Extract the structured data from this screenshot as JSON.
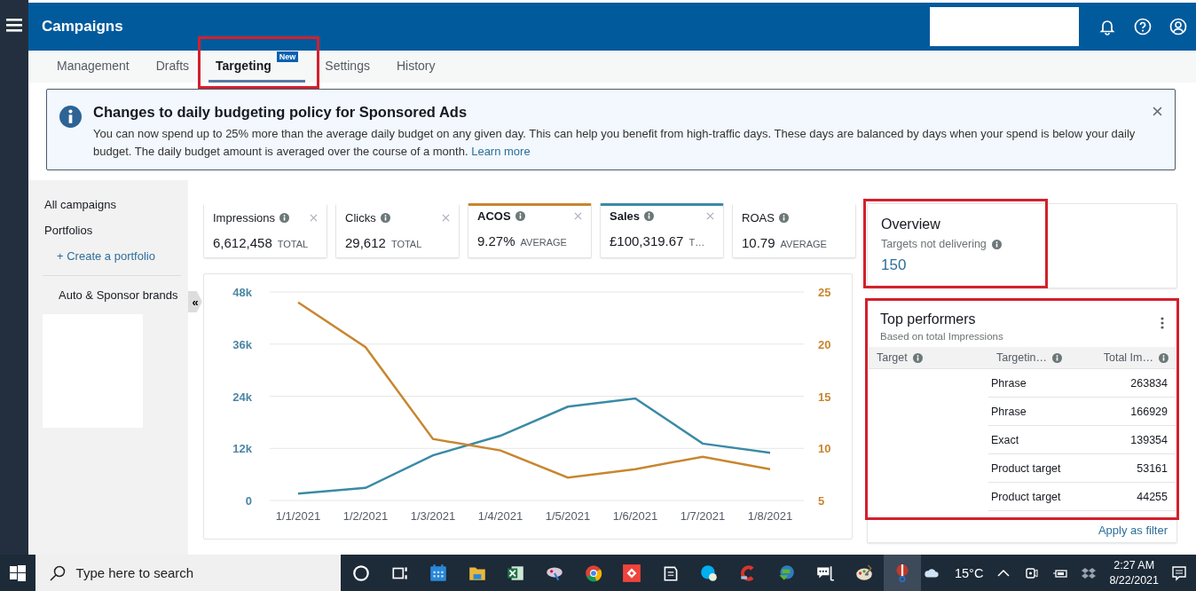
{
  "header": {
    "title": "Campaigns"
  },
  "tabs": [
    {
      "label": "Management",
      "selected": false,
      "highlighted": false
    },
    {
      "label": "Drafts",
      "selected": false,
      "highlighted": false
    },
    {
      "label": "Targeting",
      "selected": true,
      "highlighted": true,
      "badge": "New"
    },
    {
      "label": "Settings",
      "selected": false,
      "highlighted": false
    },
    {
      "label": "History",
      "selected": false,
      "highlighted": false
    }
  ],
  "banner": {
    "title": "Changes to daily budgeting policy for Sponsored Ads",
    "text": "You can now spend up to 25% more than the average daily budget on any given day. This can help you benefit from high-traffic days. These days are balanced by days when your spend is below your daily budget. The daily budget amount is averaged over the course of a month.",
    "link": "Learn more"
  },
  "sidebar": {
    "items": [
      {
        "label": "All campaigns",
        "kind": "heading"
      },
      {
        "label": "Portfolios",
        "kind": "heading"
      },
      {
        "label": "+ Create a portfolio",
        "kind": "link"
      },
      {
        "label": "Auto & Sponsor brands",
        "kind": "item"
      }
    ],
    "collapse": "«"
  },
  "metrics": [
    {
      "label": "Impressions",
      "value": "6,612,458",
      "unit": "TOTAL",
      "selected": false,
      "closable": true
    },
    {
      "label": "Clicks",
      "value": "29,612",
      "unit": "TOTAL",
      "selected": false,
      "closable": true
    },
    {
      "label": "ACOS",
      "value": "9.27%",
      "unit": "AVERAGE",
      "selected": true,
      "color": "#c8862f",
      "closable": true
    },
    {
      "label": "Sales",
      "value": "£100,319.67",
      "unit": "T…",
      "selected": true,
      "color": "#3b8aa5",
      "closable": true
    },
    {
      "label": "ROAS",
      "value": "10.79",
      "unit": "AVERAGE",
      "selected": false,
      "closable": false
    }
  ],
  "chart_data": {
    "type": "line",
    "categories": [
      "1/1/2021",
      "1/2/2021",
      "1/3/2021",
      "1/4/2021",
      "1/5/2021",
      "1/6/2021",
      "1/7/2021",
      "1/8/2021"
    ],
    "series": [
      {
        "color": "#3b8aa5",
        "values": [
          1600,
          2900,
          10400,
          14900,
          21600,
          23500,
          13100,
          11000
        ]
      },
      {
        "color": "#c8862f",
        "axis": "y2",
        "values": [
          24,
          19.7,
          10.9,
          9.8,
          7.2,
          8,
          9.2,
          8
        ]
      }
    ],
    "ylim": [
      0,
      48000
    ],
    "yticks": [
      {
        "value": 0,
        "label": "0"
      },
      {
        "value": 12000,
        "label": "12k"
      },
      {
        "value": 24000,
        "label": "24k"
      },
      {
        "value": 36000,
        "label": "36k"
      },
      {
        "value": 48000,
        "label": "48k"
      }
    ],
    "grid": true,
    "y2lim": [
      5,
      25
    ],
    "y2ticks": [
      5,
      10,
      15,
      20,
      25
    ]
  },
  "overview": {
    "title": "Overview",
    "label": "Targets not delivering",
    "value": "150",
    "highlighted": true
  },
  "top_performers": {
    "title": "Top performers",
    "subtitle": "Based on total Impressions",
    "highlighted": true,
    "columns": [
      "Target",
      "Targetin…",
      "Total Im…"
    ],
    "rows": [
      {
        "targeting": "Phrase",
        "impressions": "263834"
      },
      {
        "targeting": "Phrase",
        "impressions": "166929"
      },
      {
        "targeting": "Exact",
        "impressions": "139354"
      },
      {
        "targeting": "Product target",
        "impressions": "53161"
      },
      {
        "targeting": "Product target",
        "impressions": "44255"
      }
    ],
    "link": "Apply as filter"
  },
  "taskbar": {
    "search_placeholder": "Type here to search",
    "apps": [
      {
        "kind": "cortana",
        "selected": false
      },
      {
        "kind": "taskview",
        "selected": false
      },
      {
        "kind": "calendar",
        "selected": false
      },
      {
        "kind": "folder",
        "selected": false
      },
      {
        "kind": "spreadsheet",
        "selected": false
      },
      {
        "kind": "paint",
        "selected": false
      },
      {
        "kind": "browser",
        "selected": false
      },
      {
        "kind": "remote",
        "selected": false
      },
      {
        "kind": "notes",
        "selected": false
      },
      {
        "kind": "chat",
        "selected": false
      },
      {
        "kind": "cleaner",
        "selected": false
      },
      {
        "kind": "download",
        "selected": false
      },
      {
        "kind": "snip",
        "selected": false
      },
      {
        "kind": "palette",
        "selected": false
      },
      {
        "kind": "tool",
        "selected": true
      }
    ],
    "weather": "15°C",
    "time": "2:27 AM",
    "date": "8/22/2021"
  }
}
